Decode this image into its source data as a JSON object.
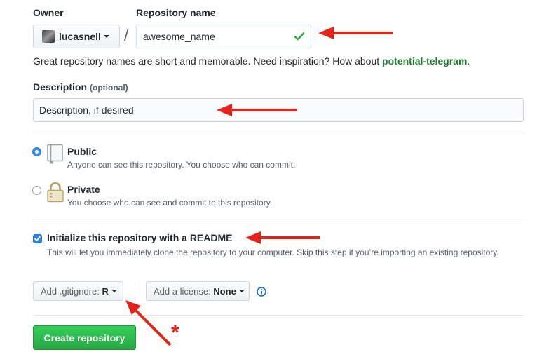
{
  "owner": {
    "label": "Owner",
    "value": "lucasnell"
  },
  "separator": "/",
  "repo_name": {
    "label": "Repository name",
    "value": "awesome_name"
  },
  "hint": {
    "text": "Great repository names are short and memorable. Need inspiration? How about ",
    "suggestion": "potential-telegram",
    "end": "."
  },
  "description": {
    "label": "Description",
    "optional": "(optional)",
    "value": "Description, if desired"
  },
  "visibility": {
    "public": {
      "title": "Public",
      "note": "Anyone can see this repository. You choose who can commit.",
      "selected": true
    },
    "private": {
      "title": "Private",
      "note": "You choose who can see and commit to this repository.",
      "selected": false
    }
  },
  "readme": {
    "title": "Initialize this repository with a README",
    "note": "This will let you immediately clone the repository to your computer. Skip this step if you’re importing an existing repository.",
    "checked": true
  },
  "gitignore": {
    "label": "Add .gitignore:",
    "value": "R"
  },
  "license": {
    "label": "Add a license:",
    "value": "None"
  },
  "create_button": "Create repository",
  "annotation_asterisk": "*",
  "colors": {
    "accent_green": "#28a745",
    "link_green": "#1e7e34",
    "arrow_red": "#e3241b",
    "info_blue": "#0366d6"
  }
}
